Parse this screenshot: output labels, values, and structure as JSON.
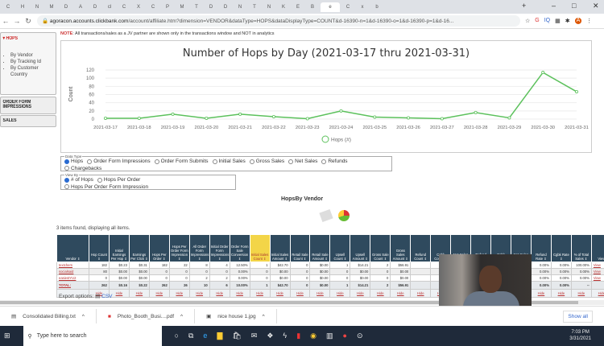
{
  "browser": {
    "url_host": "agoracon.accounts.clickbank.com",
    "url_path": "/account/affiliate.htm?dimension=VENDOR&dataType=HOPS&dataDisplayType=COUNT&d-16390-n=1&d-16390-o=1&d-16390-p=1&d-16...",
    "tabs": [
      "C",
      "H",
      "N",
      "M",
      "D",
      "A",
      "D",
      "cl",
      "C",
      "X",
      "C",
      "P",
      "M",
      "T",
      "D",
      "D",
      "N",
      "T",
      "N",
      "K",
      "E",
      "B",
      "e",
      "C",
      "x",
      "b"
    ],
    "active_tab_index": 22
  },
  "note": {
    "label": "NOTE",
    "text": ": All transactions/sales as a JV partner are shown only in the transactions window and NOT in analytics"
  },
  "sidebar": {
    "hops": "HOPS",
    "items": [
      "By Vendor",
      "By Tracking Id",
      "By Customer Country"
    ],
    "order_form": "ORDER FORM IMPRESSIONS",
    "sales": "SALES"
  },
  "chart_data": {
    "type": "line",
    "title": "Number of Hops by Day (2021-03-17 thru 2021-03-31)",
    "ylabel": "Count",
    "xlabel": "",
    "ylim": [
      0,
      120
    ],
    "yticks": [
      0,
      20,
      40,
      60,
      80,
      100,
      120
    ],
    "grid": true,
    "legend_position": "bottom",
    "categories": [
      "2021-03-17",
      "2021-03-18",
      "2021-03-19",
      "2021-03-20",
      "2021-03-21",
      "2021-03-22",
      "2021-03-23",
      "2021-03-24",
      "2021-03-25",
      "2021-03-26",
      "2021-03-27",
      "2021-03-28",
      "2021-03-29",
      "2021-03-30",
      "2021-03-31"
    ],
    "series": [
      {
        "name": "Hops (#)",
        "color": "#5cc15c",
        "values": [
          2,
          2,
          12,
          2,
          12,
          6,
          1,
          20,
          5,
          3,
          1,
          16,
          3,
          114,
          67
        ]
      }
    ]
  },
  "data_type": {
    "legend": "Data Type",
    "options": [
      "Hops",
      "Order Form Impressions",
      "Order Form Submits",
      "Initial Sales",
      "Gross Sales",
      "Net Sales",
      "Refunds",
      "Chargebacks"
    ],
    "selected": 0
  },
  "view_by": {
    "legend": "View By",
    "options": [
      "# of Hops",
      "Hops Per Order",
      "Hops Per Order Form Impression"
    ],
    "selected": 0
  },
  "section_title": "HopsBy Vendor",
  "items_found": "3 items found, displaying all items.",
  "table": {
    "headers": [
      "Vendor",
      "Hop Count",
      "Initial Earnings Per Hop",
      "Earnings Per Click",
      "Hops Per Order",
      "Hops Per Order Form Impression",
      "All Order Form Impressions",
      "Initial Order Form Impressions",
      "Order Form Sale Conversion",
      "Initial Sales Count",
      "Initial Sales Amount",
      "Retail Sale Count",
      "Retail Sale Amount",
      "Upsell Count",
      "Upsell Amount",
      "Gross Sale Count",
      "Gross Sales Amount",
      "Refund Count",
      "Cgbk Count",
      "Net Sales Count",
      "Refund Amount",
      "Cgbk Amount",
      "Net Sales Amount",
      "Refund Rate",
      "Cgbk Rate",
      "% of Total Sales",
      "View"
    ],
    "rows": [
      [
        "textchers",
        "182",
        "$0.23",
        "$0.31",
        "182",
        "22",
        "8",
        "4",
        "12.50%",
        "1",
        "$42.70",
        "0",
        "$0.00",
        "1",
        "$14.21",
        "2",
        "$56.91",
        "",
        "",
        "",
        "",
        "",
        "",
        "0.00%",
        "0.00%",
        "100.00%",
        "View"
      ],
      [
        "socialsaid",
        "80",
        "$0.00",
        "$0.00",
        "0",
        "0",
        "0",
        "0",
        "0.00%",
        "0",
        "$0.00",
        "0",
        "$0.00",
        "0",
        "$0.00",
        "0",
        "$0.00",
        "",
        "",
        "",
        "",
        "",
        "",
        "0.00%",
        "0.00%",
        "0.00%",
        "View"
      ],
      [
        "easiestYU2",
        "0",
        "$0.00",
        "$0.00",
        "0",
        "0",
        "2",
        "2",
        "0.00%",
        "0",
        "$0.00",
        "0",
        "$0.00",
        "0",
        "$0.00",
        "0",
        "$0.00",
        "",
        "",
        "",
        "",
        "",
        "",
        "0.00%",
        "0.00%",
        "0.00%",
        "View"
      ]
    ],
    "total": [
      "TOTAL:",
      "262",
      "$0.16",
      "$0.22",
      "262",
      "26",
      "10",
      "6",
      "10.00%",
      "1",
      "$42.70",
      "0",
      "$0.00",
      "1",
      "$14.21",
      "2",
      "$56.91",
      "",
      "",
      "",
      "",
      "",
      "",
      "0.00%",
      "0.00%",
      "--",
      ""
    ],
    "hide_label": "Hide"
  },
  "export": {
    "label": "Export options:",
    "csv": "CSV"
  },
  "downloads": {
    "items": [
      "Consolidated Billing.txt",
      "Photo_Booth_Busi....pdf",
      "nice house 1.jpg"
    ],
    "show_all": "Show all"
  },
  "taskbar": {
    "search_placeholder": "Type here to search",
    "time": "7:03 PM",
    "date": "3/31/2021"
  }
}
